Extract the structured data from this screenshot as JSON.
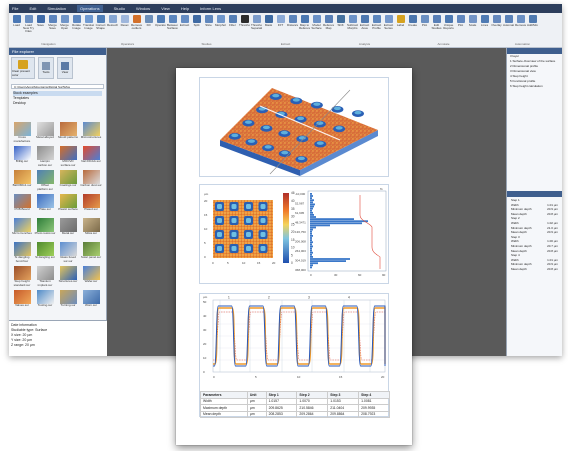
{
  "menu": {
    "items": [
      "File",
      "Edit",
      "Simulation",
      "Operations",
      "Studio",
      "Window",
      "View",
      "Help",
      "Inform Lens"
    ],
    "active_index": 3
  },
  "ribbon": {
    "buttons": [
      {
        "label": "Load",
        "color": "#4a78b5"
      },
      {
        "label": "Load New Try Files",
        "color": "#6a8fc2"
      },
      {
        "label": "Save",
        "color": "#3e6aa8"
      },
      {
        "label": "Merge Save",
        "color": "#5c84bd"
      },
      {
        "label": "Merge Open",
        "color": "#7095c8"
      },
      {
        "label": "Rotate Image",
        "color": "#5d87c0"
      },
      {
        "label": "Translate Image",
        "color": "#6f9ad2"
      },
      {
        "label": "Correct Shape",
        "color": "#4f7fb9"
      },
      {
        "label": "Retouch",
        "color": "#86a6d3"
      },
      {
        "label": "Reset",
        "color": "#9fb7dc"
      },
      {
        "label": "Remove outliers",
        "color": "#d3702a"
      },
      {
        "label": "Fill",
        "color": "#6c8fba"
      },
      {
        "label": "Operators",
        "color": "#4d7bb5"
      },
      {
        "label": "Between Surfaces",
        "color": "#5b86bf"
      },
      {
        "label": "Extract",
        "color": "#658dc4"
      },
      {
        "label": "Split",
        "color": "#3f6aa3"
      },
      {
        "label": "Slice",
        "color": "#5f87bd"
      },
      {
        "label": "Morphology",
        "color": "#6f97cc"
      },
      {
        "label": "Filter",
        "color": "#557fb6"
      },
      {
        "label": "Threshold",
        "color": "#2b2b2b"
      },
      {
        "label": "Threshold Separation",
        "color": "#7c9ccb"
      },
      {
        "label": "Mask",
        "color": "#3d6aa2"
      },
      {
        "label": "FFT",
        "color": "#8caad6"
      },
      {
        "label": "Distance",
        "color": "#5b84bb"
      },
      {
        "label": "Map to Reference",
        "color": "#4a77b1"
      },
      {
        "label": "Model Surface",
        "color": "#6a91c7"
      },
      {
        "label": "Reference Map",
        "color": "#587fb6"
      },
      {
        "label": "Shift",
        "color": "#45719f"
      },
      {
        "label": "Subtract Morphs",
        "color": "#6d93c8"
      },
      {
        "label": "Extract Area",
        "color": "#4d78b0"
      },
      {
        "label": "Extract Profile",
        "color": "#5c86bd"
      },
      {
        "label": "Extract Series",
        "color": "#7598cb"
      },
      {
        "label": "Label",
        "color": "#d6a21f"
      },
      {
        "label": "Create",
        "color": "#4a75ad"
      },
      {
        "label": "Plot",
        "color": "#6a8fc2"
      },
      {
        "label": "Edit Studies",
        "color": "#587fb7"
      },
      {
        "label": "Unique Reports",
        "color": "#4d79b2"
      },
      {
        "label": "Plot",
        "color": "#6187be"
      },
      {
        "label": "Scale",
        "color": "#7394c6"
      },
      {
        "label": "Lines",
        "color": "#4e7ab3"
      },
      {
        "label": "Overlay",
        "color": "#6588bd"
      },
      {
        "label": "Automation",
        "color": "#5a82b9"
      },
      {
        "label": "Remove",
        "color": "#6b90c4"
      },
      {
        "label": "Add/Move",
        "color": "#4f7ab0"
      }
    ],
    "groups": [
      "Navigation",
      "Operators",
      "Studies",
      "Extract",
      "Analysis",
      "Annotate",
      "Automation"
    ]
  },
  "file_explorer": {
    "title": "File explorer",
    "top_buttons": [
      "Clear present color",
      "Tools",
      "View"
    ],
    "path": "C:\\Users\\Apps\\Mountains\\Digital Surf\\Mos",
    "tree": [
      "Stock examples",
      "Templates",
      "Desktop"
    ],
    "thumbnails": [
      {
        "caption": "Cross manufacture",
        "c1": "#d9a56b",
        "c2": "#7ab3d9"
      },
      {
        "caption": "Metal alloyed",
        "c1": "#e0e0e0",
        "c2": "#9a9a9a"
      },
      {
        "caption": "Mould patterns",
        "c1": "#b96b3e",
        "c2": "#e5b36f"
      },
      {
        "caption": "Microstructures",
        "c1": "#5b8ad0",
        "c2": "#f2d05c"
      },
      {
        "caption": "Brillig.sur",
        "c1": "#3561c7",
        "c2": "#ffffff"
      },
      {
        "caption": "Hairpin carbon.sur",
        "c1": "#8d8d8d",
        "c2": "#d4d4d4"
      },
      {
        "caption": "MOCVD surface.sur",
        "c1": "#d46e2a",
        "c2": "#3e6ec2"
      },
      {
        "caption": "Nal.DICAA.sur",
        "c1": "#e44a2c",
        "c2": "#4a7fd8"
      },
      {
        "caption": "Ball.lIMG1.sur",
        "c1": "#c57f3a",
        "c2": "#f4c66a"
      },
      {
        "caption": "Offset platform.sur",
        "c1": "#4f7fb6",
        "c2": "#86b86a"
      },
      {
        "caption": "Coatings.sur",
        "c1": "#d6b45c",
        "c2": "#6b9a3c"
      },
      {
        "caption": "Carbon dust.sur",
        "c1": "#b86a3d",
        "c2": "#dcdcdc"
      },
      {
        "caption": "PCB.Board",
        "c1": "#6a8fc2",
        "c2": "#d3702a"
      },
      {
        "caption": "Plate.sur",
        "c1": "#3d6cc0",
        "c2": "#9bc3e6"
      },
      {
        "caption": "Plastic surface",
        "c1": "#e7b84d",
        "c2": "#6a9c3a"
      },
      {
        "caption": "Plated.sur",
        "c1": "#b23c2a",
        "c2": "#e69b4a"
      },
      {
        "caption": "Micro trenches",
        "c1": "#4a7fd8",
        "c2": "#f0d35f"
      },
      {
        "caption": "Photo resist.sur",
        "c1": "#2e7d3a",
        "c2": "#8ec77a"
      },
      {
        "caption": "Metal.sur",
        "c1": "#9a9a9a",
        "c2": "#6c6c6c"
      },
      {
        "caption": "Silica.sur",
        "c1": "#c9b38a",
        "c2": "#7b6a4a"
      },
      {
        "caption": "Si dangling bond.fsur",
        "c1": "#3b73c4",
        "c2": "#e3c45d"
      },
      {
        "caption": "Si dangling sur",
        "c1": "#4f8a2e",
        "c2": "#9fd05a"
      },
      {
        "caption": "Glass fused sur.sur",
        "c1": "#5c8ed1",
        "c2": "#d9d9d9"
      },
      {
        "caption": "Solar panel.sur",
        "c1": "#5a7d3a",
        "c2": "#a9cf6f"
      },
      {
        "caption": "Step height standard.sur",
        "c1": "#9a4e2a",
        "c2": "#e3a15d"
      },
      {
        "caption": "Titanium implant.sur",
        "c1": "#d0d0d0",
        "c2": "#8e8e8e"
      },
      {
        "caption": "Structures.sur",
        "c1": "#e3c45d",
        "c2": "#2a60b8"
      },
      {
        "caption": "Wafer.sur",
        "c1": "#4a7fd8",
        "c2": "#f2c24f"
      },
      {
        "caption": "Valves.sur",
        "c1": "#c65a2a",
        "c2": "#f1a85a"
      },
      {
        "caption": "Tooling.sur",
        "c1": "#4e8ac8",
        "c2": "#f0f0f0"
      },
      {
        "caption": "Turning.sur",
        "c1": "#c9a65a",
        "c2": "#6d8dbd"
      },
      {
        "caption": "Worn.sur",
        "c1": "#8bb0d9",
        "c2": "#3d6aa8"
      }
    ],
    "info": [
      "Date information",
      "Studiable type: Surface",
      "X size: 20 µm",
      "Y size: 20 µm",
      "Z range: 20 µm"
    ]
  },
  "right_panel": {
    "tree": [
      "3 layer",
      "1 Surface-Overview of the surface",
      "2 Dimensional profile",
      "3 Dimensional view",
      "4 Step height",
      "5 Functional profile",
      "6 Step height calculation"
    ],
    "table": [
      {
        "k": "Step 1",
        "v": ""
      },
      {
        "k": "Width",
        "v": "1.01 µm"
      },
      {
        "k": "Minimum depth",
        "v": "20.9 µm"
      },
      {
        "k": "Mean depth",
        "v": "20.8 µm"
      },
      {
        "k": "Step 2",
        "v": ""
      },
      {
        "k": "Width",
        "v": "1.02 µm"
      },
      {
        "k": "Minimum depth",
        "v": "21.0 µm"
      },
      {
        "k": "Mean depth",
        "v": "20.9 µm"
      },
      {
        "k": "Step 3",
        "v": ""
      },
      {
        "k": "Width",
        "v": "1.00 µm"
      },
      {
        "k": "Minimum depth",
        "v": "20.7 µm"
      },
      {
        "k": "Mean depth",
        "v": "20.8 µm"
      },
      {
        "k": "Step 4",
        "v": ""
      },
      {
        "k": "Width",
        "v": "1.01 µm"
      },
      {
        "k": "Minimum depth",
        "v": "20.9 µm"
      },
      {
        "k": "Mean depth",
        "v": "20.8 µm"
      }
    ]
  },
  "document": {
    "colorbar_ticks": [
      "46",
      "40",
      "35",
      "30",
      "25",
      "20",
      "15",
      "10",
      "5",
      "0"
    ],
    "map_axis": {
      "x_ticks": [
        "0",
        "5",
        "10",
        "15",
        "20"
      ],
      "unit": "µm"
    },
    "histogram": {
      "y_ticks": [
        "-10,000",
        "52,987",
        "61,995",
        "48,3471",
        "136,750",
        "206,008",
        "264,003",
        "304,019",
        "368,000"
      ],
      "x_ticks": [
        "0",
        "30",
        "60",
        "90"
      ],
      "unit": "%"
    },
    "profile": {
      "y_ticks": [
        "50",
        "40",
        "30",
        "20",
        "10",
        "0"
      ],
      "x_ticks": [
        "0",
        "5",
        "10",
        "15",
        "20"
      ],
      "unit": "µm",
      "markers": [
        "1",
        "2",
        "3",
        "4"
      ]
    },
    "table": {
      "headers": [
        "Parameters",
        "Unit",
        "Step 1",
        "Step 2",
        "Step 3",
        "Step 4"
      ],
      "rows": [
        [
          "Width",
          "µm",
          "1.0157",
          "1.0070",
          "1.0153",
          "1.0081"
        ],
        [
          "Maximum depth",
          "µm",
          "209.8625",
          "210.5846",
          "211.0404",
          "209.9935"
        ],
        [
          "Mean depth",
          "µm",
          "208.2853",
          "209.2864",
          "209.8864",
          "208.7923"
        ]
      ]
    }
  }
}
